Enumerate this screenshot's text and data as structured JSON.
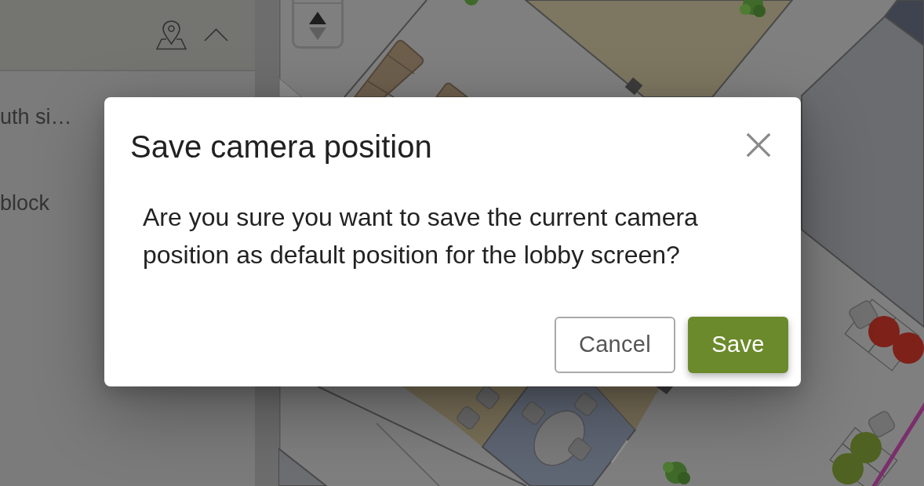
{
  "sidebar": {
    "items": [
      {
        "label": "uth si…"
      },
      {
        "label": "block"
      }
    ]
  },
  "map": {
    "tilt_controls": [
      {
        "kind": "up",
        "disabled": false
      },
      {
        "kind": "down",
        "disabled": true
      }
    ],
    "markers": [
      {
        "color": "#7e2119"
      },
      {
        "color": "#7e2119"
      },
      {
        "color": "#4f6221"
      },
      {
        "color": "#4f6221"
      }
    ]
  },
  "dialog": {
    "title": "Save camera position",
    "message": "Are you sure you want to save the current camera position as default position for the lobby screen?",
    "buttons": [
      {
        "label": "Cancel",
        "kind": "secondary"
      },
      {
        "label": "Save",
        "kind": "primary"
      }
    ]
  }
}
